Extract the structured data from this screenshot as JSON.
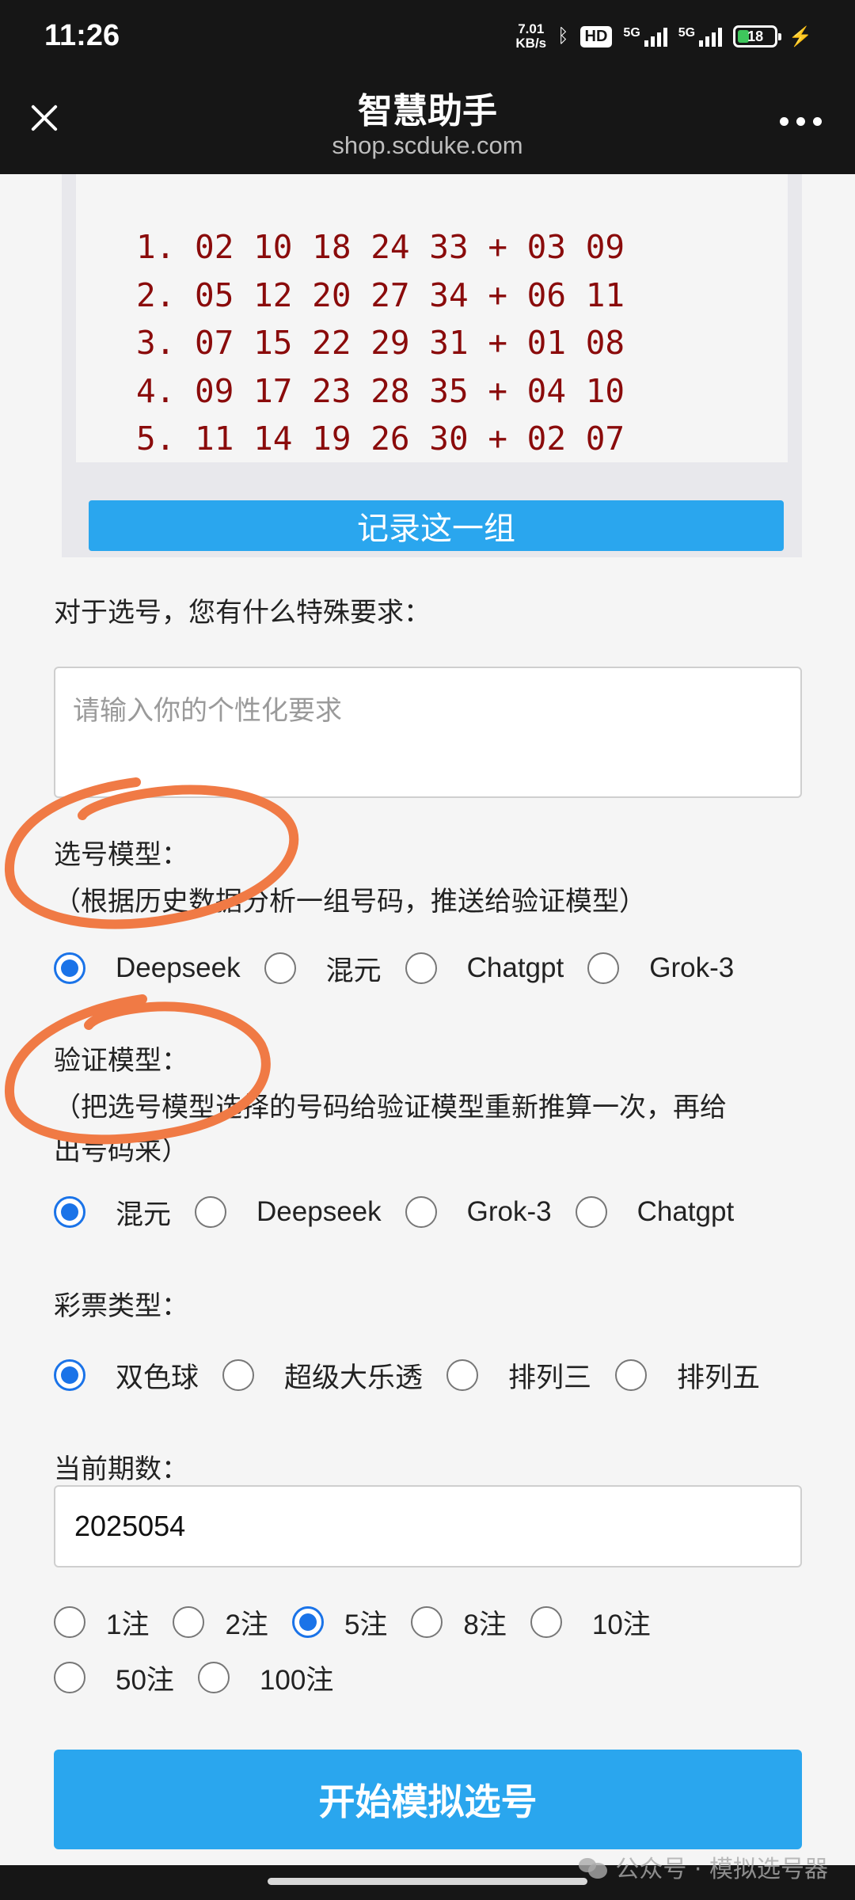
{
  "status_bar": {
    "time": "11:26",
    "net_speed_value": "7.01",
    "net_speed_unit": "KB/s",
    "hd_badge": "HD",
    "signal_label_1": "5G",
    "signal_label_2": "5G",
    "battery": "18"
  },
  "header": {
    "title": "智慧助手",
    "subtitle": "shop.scduke.com"
  },
  "results": {
    "rows": [
      "1. 02 10 18 24 33 + 03 09",
      "2. 05 12 20 27 34 + 06 11",
      "3. 07 15 22 29 31 + 01 08",
      "4. 09 17 23 28 35 + 04 10",
      "5. 11 14 19 26 30 + 02 07"
    ],
    "record_button": "记录这一组"
  },
  "special_request": {
    "label": "对于选号，您有什么特殊要求：",
    "placeholder": "请输入你的个性化要求"
  },
  "pick_model": {
    "label": "选号模型：",
    "hint": "（根据历史数据分析一组号码，推送给验证模型）",
    "options": [
      "Deepseek",
      "混元",
      "Chatgpt",
      "Grok-3"
    ],
    "selected": "Deepseek"
  },
  "verify_model": {
    "label": "验证模型：",
    "hint_line1": "（把选号模型选择的号码给验证模型重新推算一次，再给",
    "hint_line2": "出号码来）",
    "options": [
      "混元",
      "Deepseek",
      "Grok-3",
      "Chatgpt"
    ],
    "selected": "混元"
  },
  "lottery_type": {
    "label": "彩票类型：",
    "options": [
      "双色球",
      "超级大乐透",
      "排列三",
      "排列五"
    ],
    "selected": "双色球"
  },
  "period": {
    "label": "当前期数：",
    "value": "2025054"
  },
  "bet_count": {
    "options": [
      "1注",
      "2注",
      "5注",
      "8注",
      "10注",
      "50注",
      "100注"
    ],
    "selected": "5注"
  },
  "start_button": "开始模拟选号",
  "watermark": "公众号 · 模拟选号器",
  "colors": {
    "accent": "#2aa6ee",
    "radio_checked": "#1a73e8",
    "result_text": "#8a0b0b",
    "annotation": "#f07a45"
  }
}
